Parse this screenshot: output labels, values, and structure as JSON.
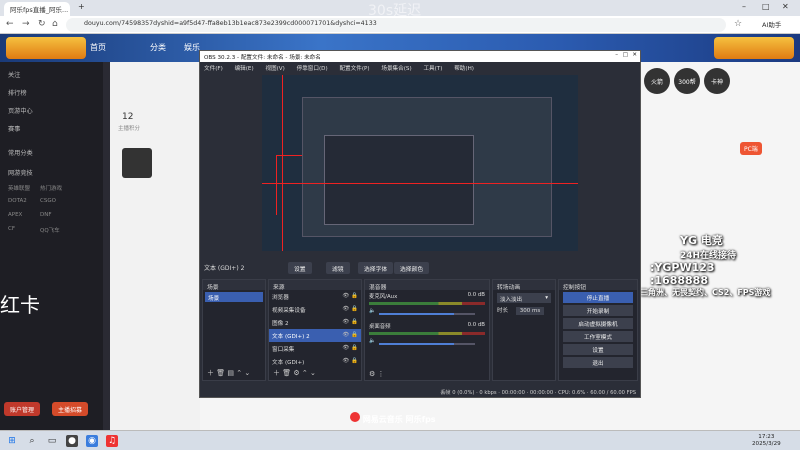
{
  "browser": {
    "tab_title": "阿乐fps直播_阿乐...",
    "url": "douyu.com/74598357dyshid=a9f5d47-ffa8eb13b1eac873e2399cd000071701&dyshci=4133",
    "ai_label": "AI助手",
    "overlay": "30s延迟"
  },
  "douyu": {
    "nav": [
      "首页",
      "分类",
      "娱乐"
    ],
    "left_menu": [
      "关注",
      "排行榜",
      "页游中心",
      "赛事",
      "常用分类",
      "网游竞技"
    ],
    "left_small": [
      "英雄联盟",
      "热门游戏",
      "DOTA2",
      "CSGO",
      "APEX",
      "DNF",
      "CF",
      "QQ飞车"
    ],
    "big_red_text": "红卡",
    "buttons": [
      "账户管理",
      "主播招募"
    ],
    "room_count": "12",
    "room_label": "主播积分",
    "yg": {
      "line1": "YG 电竞",
      "line2": "24H在线接待",
      "line3": ":YGPW123",
      "line4": ":1688888",
      "line5": "三角洲、无畏契约、CS2、FPS游戏"
    },
    "badges": [
      "火箭",
      "300帮",
      "卡神",
      "PC端"
    ],
    "netease": "网易云音乐",
    "netease_name": "阿乐fps"
  },
  "obs": {
    "title": "OBS 30.2.3 - 配置文件: 未命名 - 场景: 未命名",
    "menu": [
      "文件(F)",
      "编辑(E)",
      "视图(V)",
      "停靠窗口(D)",
      "配置文件(P)",
      "场景集合(S)",
      "工具(T)",
      "帮助(H)"
    ],
    "source_label": "文本 (GDI+) 2",
    "preview_buttons": [
      "设置",
      "滤镜",
      "选择字体",
      "选择颜色"
    ],
    "docks": {
      "scenes": {
        "title": "场景",
        "items": [
          "场景"
        ]
      },
      "sources": {
        "title": "来源",
        "items": [
          "浏览器",
          "视频采集设备",
          "图像 2",
          "文本 (GDI+) 2",
          "窗口采集",
          "文本 (GDI+)"
        ]
      },
      "mixer": {
        "title": "混音器",
        "tracks": [
          {
            "name": "麦克风/Aux",
            "db": "0.0 dB"
          },
          {
            "name": "桌面音频",
            "db": "0.0 dB"
          }
        ]
      },
      "transitions": {
        "title": "转场动画",
        "type": "淡入淡出",
        "duration_label": "时长",
        "duration": "300 ms"
      },
      "controls": {
        "title": "控制按钮",
        "buttons": [
          "停止直播",
          "开始录制",
          "启动虚拟摄像机",
          "工作室模式",
          "设置",
          "退出"
        ]
      }
    },
    "status": {
      "dropped": "丢帧 0 (0.0%)",
      "kbps": "0 kbps",
      "time1": "00:00:00",
      "time2": "00:00:00",
      "cpu": "CPU: 0.6%",
      "fps": "60.00 / 60.00 FPS"
    }
  },
  "taskbar": {
    "time": "17:23",
    "date": "2025/3/29"
  }
}
